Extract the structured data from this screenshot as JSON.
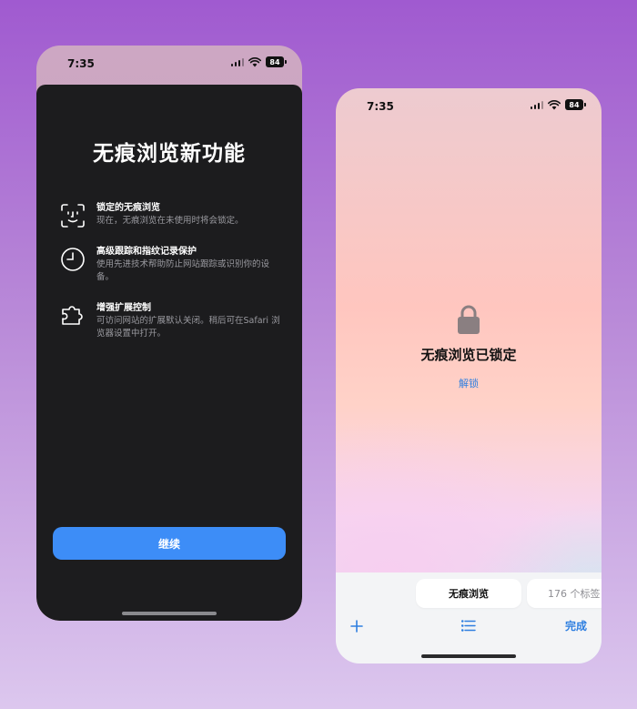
{
  "left_phone": {
    "status": {
      "time": "7:35",
      "battery": "84"
    },
    "title": "无痕浏览新功能",
    "features": [
      {
        "icon": "face-id-icon",
        "heading": "锁定的无痕浏览",
        "description": "现在，无痕浏览在未使用时将会锁定。"
      },
      {
        "icon": "clock-icon",
        "heading": "高级跟踪和指纹记录保护",
        "description": "使用先进技术帮助防止网站跟踪或识别你的设备。"
      },
      {
        "icon": "puzzle-extension-icon",
        "heading": "增强扩展控制",
        "description": "可访问网站的扩展默认关闭。稍后可在Safari 浏览器设置中打开。"
      }
    ],
    "continue_label": "继续"
  },
  "right_phone": {
    "status": {
      "time": "7:35",
      "battery": "84"
    },
    "locked_title": "无痕浏览已锁定",
    "unlock_label": "解锁",
    "tabs": {
      "private_label": "无痕浏览",
      "tab_count_label": "176 个标签"
    },
    "done_label": "完成"
  },
  "colors": {
    "accent": "#3d8df7",
    "link": "#2f7fe0",
    "sheet_bg": "#1c1c1e"
  }
}
